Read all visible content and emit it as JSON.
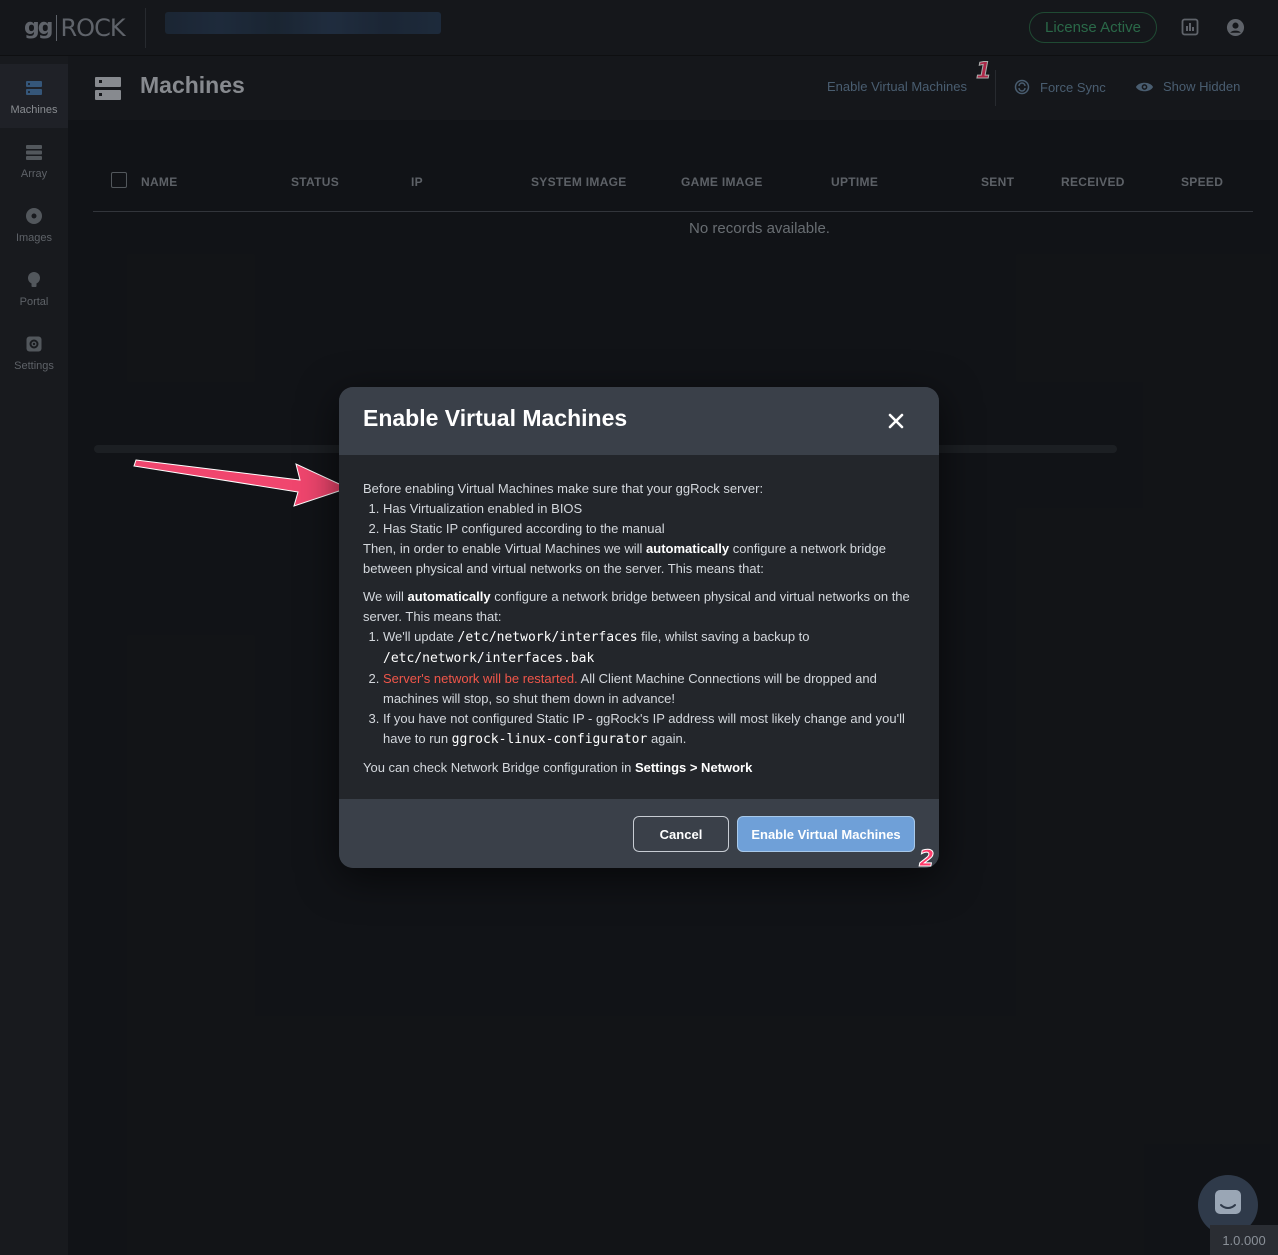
{
  "topbar": {
    "logo_gg": "gg",
    "logo_rock": "ROCK",
    "license_label": "License Active"
  },
  "sidebar": {
    "items": [
      {
        "label": "Machines",
        "icon": "server-icon",
        "active": true
      },
      {
        "label": "Array",
        "icon": "array-icon",
        "active": false
      },
      {
        "label": "Images",
        "icon": "disc-icon",
        "active": false
      },
      {
        "label": "Portal",
        "icon": "bulb-icon",
        "active": false
      },
      {
        "label": "Settings",
        "icon": "gear-icon",
        "active": false
      }
    ]
  },
  "header": {
    "title": "Machines",
    "enable_vm_label": "Enable Virtual Machines",
    "force_sync_label": "Force Sync",
    "show_hidden_label": "Show Hidden",
    "annotation_1": "1"
  },
  "table": {
    "columns": [
      "NAME",
      "STATUS",
      "IP",
      "SYSTEM IMAGE",
      "GAME IMAGE",
      "UPTIME",
      "SENT",
      "RECEIVED",
      "SPEED"
    ],
    "empty_text": "No records available."
  },
  "modal": {
    "title": "Enable Virtual Machines",
    "intro": "Before enabling Virtual Machines make sure that your ggRock server:",
    "req_1": "Has Virtualization enabled in BIOS",
    "req_2": "Has Static IP configured according to the manual",
    "then_a": "Then, in order to enable Virtual Machines we will ",
    "then_bold": "automatically",
    "then_b": " configure a network bridge between physical and virtual networks on the server. This means that:",
    "we_a": "We will ",
    "we_bold": "automatically",
    "we_b": " configure a network bridge between physical and virtual networks on the server. This means that:",
    "step1_a": "We'll update ",
    "step1_code1": "/etc/network/interfaces",
    "step1_b": " file, whilst saving a backup to ",
    "step1_code2": "/etc/network/interfaces.bak",
    "step2_red": "Server's network will be restarted.",
    "step2_b": " All Client Machine Connections will be dropped and machines will stop, so shut them down in advance!",
    "step3_a": "If you have not configured Static IP - ggRock's IP address will most likely change and you'll have to run ",
    "step3_code": "ggrock-linux-configurator",
    "step3_b": " again.",
    "check_a": "You can check Network Bridge configuration in ",
    "check_bold": "Settings > Network",
    "cancel_label": "Cancel",
    "enable_label": "Enable Virtual Machines",
    "annotation_2": "2"
  },
  "footer": {
    "version": "1.0.000"
  },
  "colors": {
    "accent_blue": "#6fa0d8",
    "license_green": "#3e9a6b",
    "warning_red": "#f0564a",
    "annotation_pink": "#ff3b6b"
  }
}
